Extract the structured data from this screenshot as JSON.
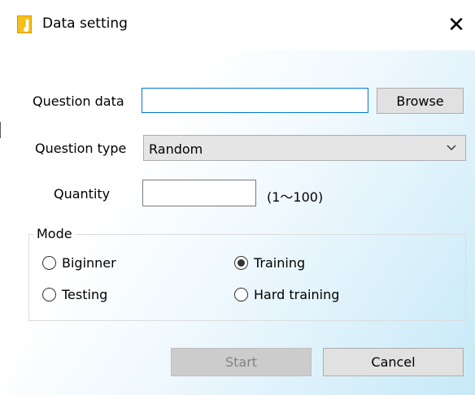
{
  "window": {
    "title": "Data setting",
    "close_symbol": "✕",
    "app_icon": "app-music-note-icon"
  },
  "form": {
    "question_data_label": "Question data",
    "question_data_value": "",
    "browse_label": "Browse",
    "question_type_label": "Question type",
    "question_type_value": "Random",
    "quantity_label": "Quantity",
    "quantity_value": "",
    "quantity_range": "(1～100)"
  },
  "mode": {
    "title": "Mode",
    "options": [
      {
        "label": "Biginner",
        "selected": false
      },
      {
        "label": "Training",
        "selected": true
      },
      {
        "label": "Testing",
        "selected": false
      },
      {
        "label": "Hard training",
        "selected": false
      }
    ]
  },
  "buttons": {
    "start_label": "Start",
    "start_enabled": false,
    "cancel_label": "Cancel"
  },
  "colors": {
    "accent_focus": "#0078d7",
    "icon_yellow": "#f6c01a",
    "gradient_end": "#c6e9f8"
  }
}
